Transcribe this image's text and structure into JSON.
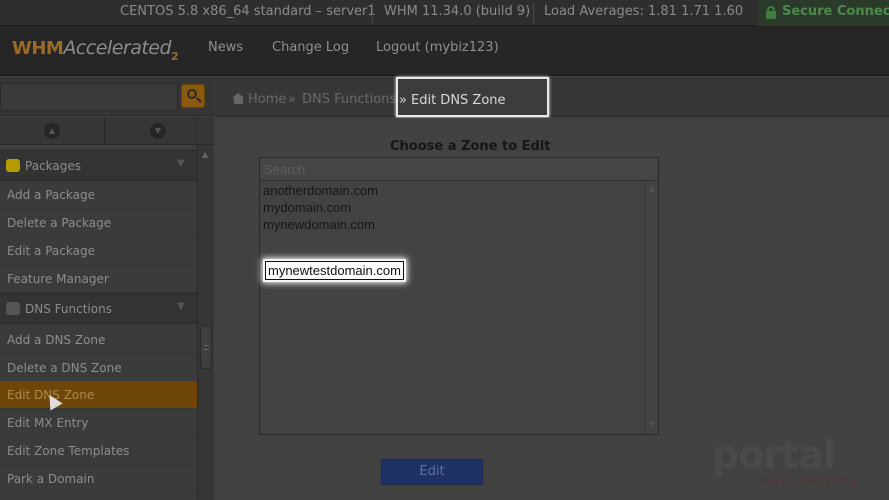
{
  "statusbar": {
    "os": "CENTOS 5.8 x86_64 standard – server1",
    "version": "WHM 11.34.0 (build 9)",
    "load": "Load Averages: 1.81 1.71 1.60",
    "secure": "Secure Connection"
  },
  "header": {
    "logo_whm": "WHM",
    "logo_accelerated": "Accelerated",
    "logo_version": "2",
    "nav": [
      "News",
      "Change Log",
      "Logout (mybiz123)"
    ]
  },
  "sidebar": {
    "categories": [
      {
        "label": "Packages",
        "icon": "package-icon",
        "color": "#b59a00"
      },
      {
        "label": "DNS Functions",
        "icon": "dns-icon",
        "color": "#555555"
      }
    ],
    "packages_items": [
      "Add a Package",
      "Delete a Package",
      "Edit a Package",
      "Feature Manager"
    ],
    "dns_items": [
      "Add a DNS Zone",
      "Delete a DNS Zone",
      "Edit DNS Zone",
      "Edit MX Entry",
      "Edit Zone Templates",
      "Park a Domain"
    ],
    "active_item": "Edit DNS Zone"
  },
  "breadcrumb": {
    "home": "Home",
    "sep": "»",
    "section": "DNS Functions",
    "current": "Edit DNS Zone"
  },
  "main": {
    "title": "Choose a Zone to Edit",
    "search_placeholder": "Search",
    "zones": [
      "anotherdomain.com",
      "mydomain.com",
      "mynewdomain.com",
      "mynewtestdomain.com"
    ],
    "selected_zone": "mynewtestdomain.com",
    "edit_button": "Edit"
  },
  "watermark": {
    "big": "portal",
    "small": "web hosting"
  },
  "colors": {
    "accent_orange": "#8a5a10",
    "active_item_bg": "#6e4608",
    "edit_button_bg": "#1f3266",
    "secure_green": "#4c8a4c"
  }
}
